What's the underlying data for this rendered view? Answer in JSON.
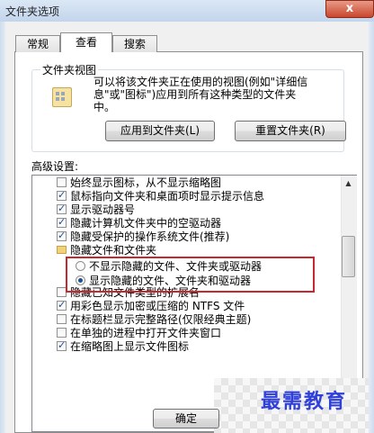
{
  "window": {
    "title": "文件夹选项",
    "close_label": "x"
  },
  "tabs": [
    {
      "label": "常规"
    },
    {
      "label": "查看"
    },
    {
      "label": "搜索"
    }
  ],
  "folder_views": {
    "group_label": "文件夹视图",
    "description_lines": [
      "可以将该文件夹正在使用的视图(例如\"详细信",
      "息\"或\"图标\")应用到所有这种类型的文件夹",
      "中。"
    ],
    "apply_button": "应用到文件夹(L)",
    "reset_button": "重置文件夹(R)"
  },
  "advanced": {
    "label": "高级设置:",
    "items": [
      {
        "type": "checkbox",
        "checked": false,
        "label": "始终显示图标，从不显示缩略图"
      },
      {
        "type": "checkbox",
        "checked": true,
        "label": "鼠标指向文件夹和桌面项时显示提示信息"
      },
      {
        "type": "checkbox",
        "checked": true,
        "label": "显示驱动器号"
      },
      {
        "type": "checkbox",
        "checked": true,
        "label": "隐藏计算机文件夹中的空驱动器"
      },
      {
        "type": "checkbox",
        "checked": true,
        "label": "隐藏受保护的操作系统文件(推荐)"
      },
      {
        "type": "folder",
        "label": "隐藏文件和文件夹"
      },
      {
        "type": "radio",
        "checked": false,
        "label": "不显示隐藏的文件、文件夹或驱动器"
      },
      {
        "type": "radio",
        "checked": true,
        "label": "显示隐藏的文件、文件夹和驱动器"
      },
      {
        "type": "checkbox",
        "checked": false,
        "label": "隐藏已知文件类型的扩展名"
      },
      {
        "type": "checkbox",
        "checked": true,
        "label": "用彩色显示加密或压缩的 NTFS 文件"
      },
      {
        "type": "checkbox",
        "checked": false,
        "label": "在标题栏显示完整路径(仅限经典主题)"
      },
      {
        "type": "checkbox",
        "checked": false,
        "label": "在单独的进程中打开文件夹窗口"
      },
      {
        "type": "checkbox",
        "checked": true,
        "label": "在缩略图上显示文件图标"
      }
    ]
  },
  "footer": {
    "ok_button": "确定"
  },
  "watermark": {
    "text": "最需教育"
  },
  "colors": {
    "highlight_box": "#c8282c",
    "watermark_text": "#2f3fd9"
  }
}
